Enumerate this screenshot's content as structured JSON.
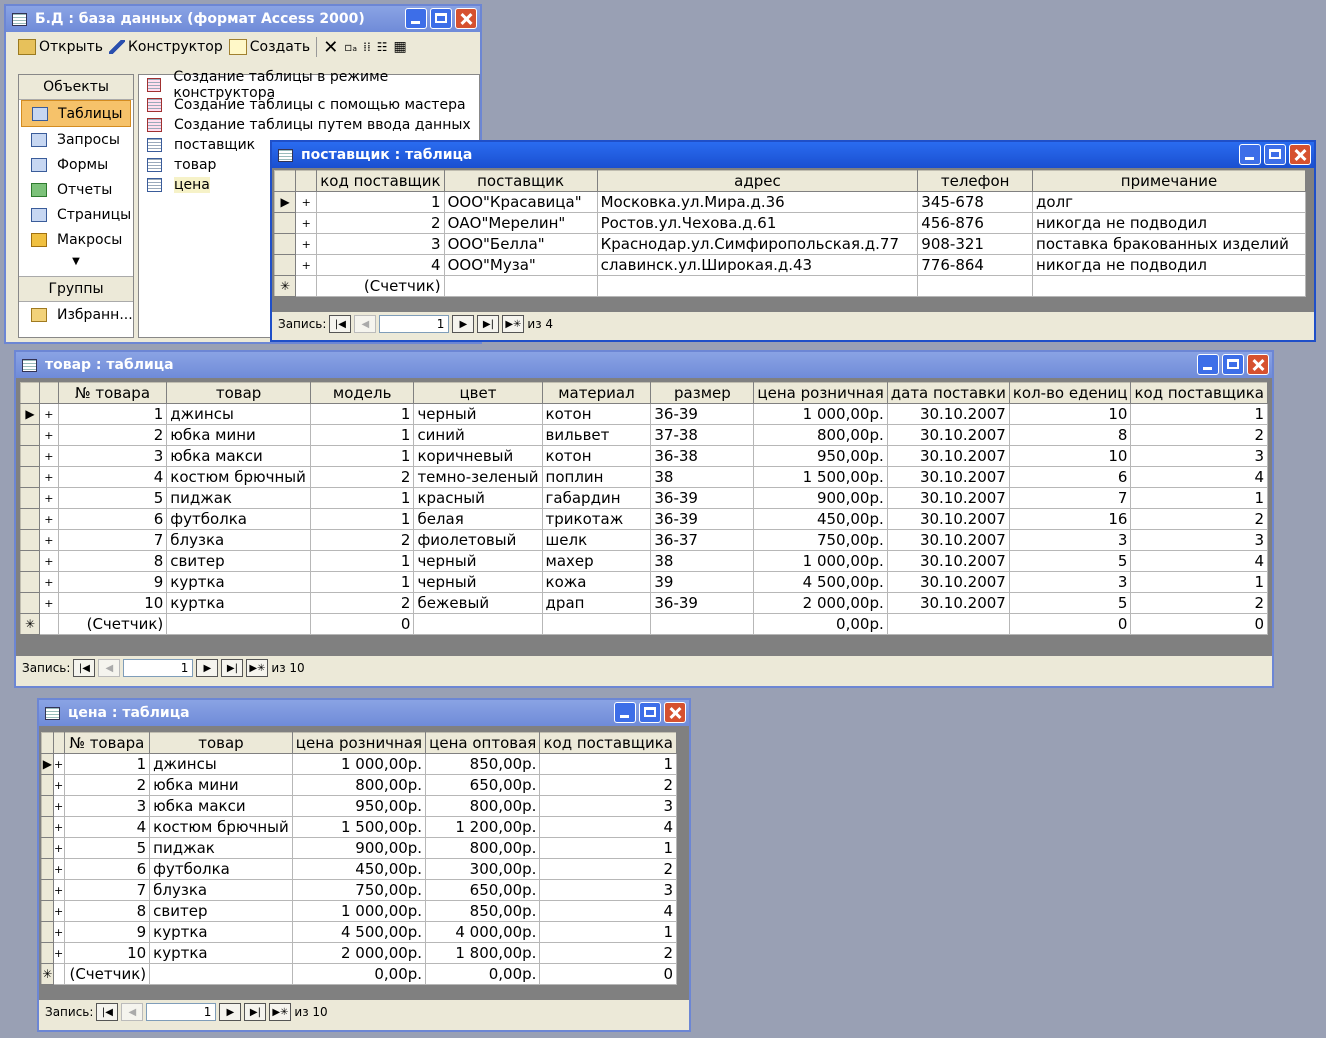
{
  "db_window": {
    "title": "Б.Д : база данных (формат Access 2000)",
    "toolbar": {
      "open": "Открыть",
      "design": "Конструктор",
      "create": "Создать"
    },
    "objects_header": "Объекты",
    "objects": [
      "Таблицы",
      "Запросы",
      "Формы",
      "Отчеты",
      "Страницы",
      "Макросы"
    ],
    "groups_header": "Группы",
    "favorites": "Избранн...",
    "list": [
      "Создание таблицы в режиме конструктора",
      "Создание таблицы с помощью мастера",
      "Создание таблицы путем ввода данных",
      "поставщик",
      "товар",
      "цена"
    ]
  },
  "supplier_window": {
    "title": "поставщик : таблица",
    "columns": [
      "код поставщик",
      "поставщик",
      "адрес",
      "телефон",
      "примечание"
    ],
    "rows": [
      [
        "1",
        "ООО\"Красавица\"",
        "Московка.ул.Мира.д.36",
        "345-678",
        "долг"
      ],
      [
        "2",
        "ОАО\"Мерелин\"",
        "Ростов.ул.Чехова.д.61",
        "456-876",
        "никогда не подводил"
      ],
      [
        "3",
        "ООО\"Белла\"",
        "Краснодар.ул.Симфиропольская.д.77",
        "908-321",
        "поставка бракованных изделий"
      ],
      [
        "4",
        "ООО\"Муза\"",
        "славинск.ул.Широкая.д.43",
        "776-864",
        "никогда не подводил"
      ]
    ],
    "new_row": "(Счетчик)",
    "nav": {
      "label": "Запись:",
      "current": "1",
      "of": "из  4"
    }
  },
  "goods_window": {
    "title": "товар : таблица",
    "columns": [
      "№ товара",
      "товар",
      "модель",
      "цвет",
      "материал",
      "размер",
      "цена розничная",
      "дата поставки",
      "кол-во едениц",
      "код поставщика"
    ],
    "rows": [
      [
        "1",
        "джинсы",
        "1",
        "черный",
        "котон",
        "36-39",
        "1 000,00р.",
        "30.10.2007",
        "10",
        "1"
      ],
      [
        "2",
        "юбка мини",
        "1",
        "синий",
        "вильвет",
        "37-38",
        "800,00р.",
        "30.10.2007",
        "8",
        "2"
      ],
      [
        "3",
        "юбка макси",
        "1",
        "коричневый",
        "котон",
        "36-38",
        "950,00р.",
        "30.10.2007",
        "10",
        "3"
      ],
      [
        "4",
        "костюм брючный",
        "2",
        "темно-зеленый",
        "поплин",
        "38",
        "1 500,00р.",
        "30.10.2007",
        "6",
        "4"
      ],
      [
        "5",
        "пиджак",
        "1",
        "красный",
        "габардин",
        "36-39",
        "900,00р.",
        "30.10.2007",
        "7",
        "1"
      ],
      [
        "6",
        "футболка",
        "1",
        "белая",
        "трикотаж",
        "36-39",
        "450,00р.",
        "30.10.2007",
        "16",
        "2"
      ],
      [
        "7",
        "блузка",
        "2",
        "фиолетовый",
        "шелк",
        "36-37",
        "750,00р.",
        "30.10.2007",
        "3",
        "3"
      ],
      [
        "8",
        "свитер",
        "1",
        "черный",
        "махер",
        "38",
        "1 000,00р.",
        "30.10.2007",
        "5",
        "4"
      ],
      [
        "9",
        "куртка",
        "1",
        "черный",
        "кожа",
        "39",
        "4 500,00р.",
        "30.10.2007",
        "3",
        "1"
      ],
      [
        "10",
        "куртка",
        "2",
        "бежевый",
        "драп",
        "36-39",
        "2 000,00р.",
        "30.10.2007",
        "5",
        "2"
      ]
    ],
    "new_row": [
      "(Счетчик)",
      "",
      "0",
      "",
      "",
      "",
      "0,00р.",
      "",
      "0",
      "0"
    ],
    "nav": {
      "label": "Запись:",
      "current": "1",
      "of": "из  10"
    }
  },
  "price_window": {
    "title": "цена : таблица",
    "columns": [
      "№ товара",
      "товар",
      "цена розничная",
      "цена оптовая",
      "код поставщика"
    ],
    "rows": [
      [
        "1",
        "джинсы",
        "1 000,00р.",
        "850,00р.",
        "1"
      ],
      [
        "2",
        "юбка мини",
        "800,00р.",
        "650,00р.",
        "2"
      ],
      [
        "3",
        "юбка макси",
        "950,00р.",
        "800,00р.",
        "3"
      ],
      [
        "4",
        "костюм брючный",
        "1 500,00р.",
        "1 200,00р.",
        "4"
      ],
      [
        "5",
        "пиджак",
        "900,00р.",
        "800,00р.",
        "1"
      ],
      [
        "6",
        "футболка",
        "450,00р.",
        "300,00р.",
        "2"
      ],
      [
        "7",
        "блузка",
        "750,00р.",
        "650,00р.",
        "3"
      ],
      [
        "8",
        "свитер",
        "1 000,00р.",
        "850,00р.",
        "4"
      ],
      [
        "9",
        "куртка",
        "4 500,00р.",
        "4 000,00р.",
        "1"
      ],
      [
        "10",
        "куртка",
        "2 000,00р.",
        "1 800,00р.",
        "2"
      ]
    ],
    "new_row": [
      "(Счетчик)",
      "",
      "0,00р.",
      "0,00р.",
      "0"
    ],
    "nav": {
      "label": "Запись:",
      "current": "1",
      "of": "из  10"
    }
  }
}
